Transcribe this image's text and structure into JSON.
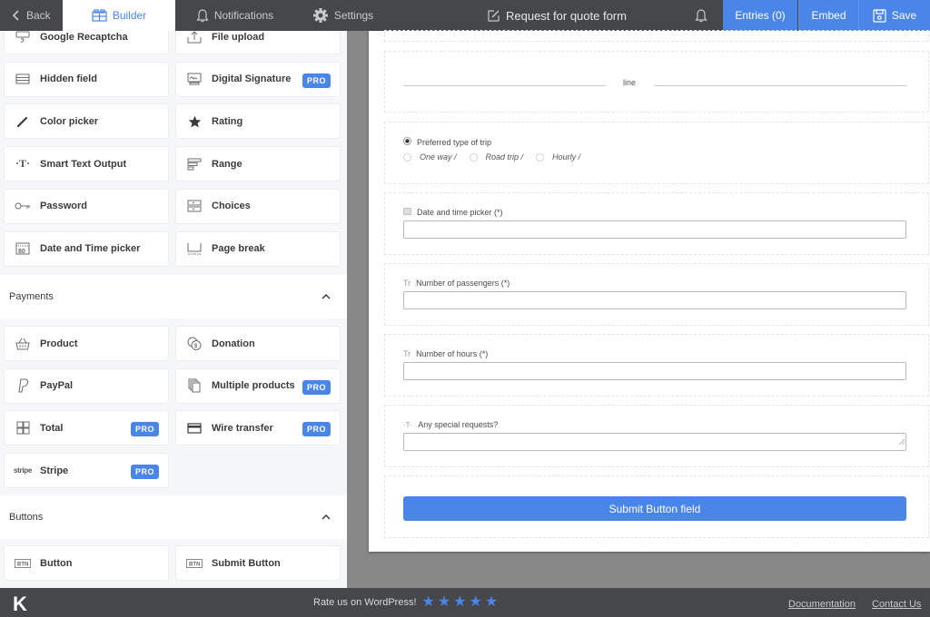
{
  "topbar": {
    "back_label": "Back",
    "builder_label": "Builder",
    "notifications_label": "Notifications",
    "settings_label": "Settings",
    "form_title": "Request for quote form",
    "entries_label": "Entries (0)",
    "embed_label": "Embed",
    "save_label": "Save"
  },
  "sidebar": {
    "general_items": [
      {
        "label": "Google Recaptcha",
        "icon": "recaptcha-icon",
        "pro": false
      },
      {
        "label": "File upload",
        "icon": "upload-icon",
        "pro": false
      },
      {
        "label": "Hidden field",
        "icon": "hidden-field-icon",
        "pro": false
      },
      {
        "label": "Digital Signature",
        "icon": "signature-icon",
        "pro": true
      },
      {
        "label": "Color picker",
        "icon": "pen-icon",
        "pro": false
      },
      {
        "label": "Rating",
        "icon": "star-icon",
        "pro": false
      },
      {
        "label": "Smart Text Output",
        "icon": "text-output-icon",
        "pro": false
      },
      {
        "label": "Range",
        "icon": "range-icon",
        "pro": false
      },
      {
        "label": "Password",
        "icon": "key-icon",
        "pro": false
      },
      {
        "label": "Choices",
        "icon": "choices-icon",
        "pro": false
      },
      {
        "label": "Date and Time picker",
        "icon": "calendar-icon",
        "pro": false
      },
      {
        "label": "Page break",
        "icon": "page-break-icon",
        "pro": false
      }
    ],
    "payments": {
      "title": "Payments",
      "items": [
        {
          "label": "Product",
          "icon": "basket-icon",
          "pro": false
        },
        {
          "label": "Donation",
          "icon": "coins-icon",
          "pro": false
        },
        {
          "label": "PayPal",
          "icon": "paypal-icon",
          "pro": false
        },
        {
          "label": "Multiple products",
          "icon": "copies-icon",
          "pro": true
        },
        {
          "label": "Total",
          "icon": "calculator-icon",
          "pro": true
        },
        {
          "label": "Wire transfer",
          "icon": "card-icon",
          "pro": true
        },
        {
          "label": "Stripe",
          "icon": "stripe-icon",
          "pro": true
        }
      ]
    },
    "buttons": {
      "title": "Buttons",
      "items": [
        {
          "label": "Button",
          "icon": "btn-icon",
          "pro": false
        },
        {
          "label": "Submit Button",
          "icon": "btn-icon",
          "pro": false
        }
      ]
    },
    "pro_badge": "PRO"
  },
  "form": {
    "divider_label": "line",
    "trip": {
      "label": "Preferred type of trip",
      "options": [
        "One way /",
        "Road trip /",
        "Hourly /"
      ]
    },
    "fields": [
      {
        "label": "Date and time picker (*)",
        "value": ""
      },
      {
        "label": "Number of passengers (*)",
        "value": ""
      },
      {
        "label": "Number of hours (*)",
        "value": ""
      },
      {
        "label": "Any special requests?",
        "value": ""
      }
    ],
    "submit_label": "Submit Button field"
  },
  "footer": {
    "logo": "K",
    "rate_text": "Rate us on WordPress!",
    "stars": 5,
    "documentation_label": "Documentation",
    "contact_label": "Contact Us"
  },
  "colors": {
    "accent": "#4a86e8",
    "topbar_bg": "#46474b",
    "canvas_bg": "#888888"
  }
}
